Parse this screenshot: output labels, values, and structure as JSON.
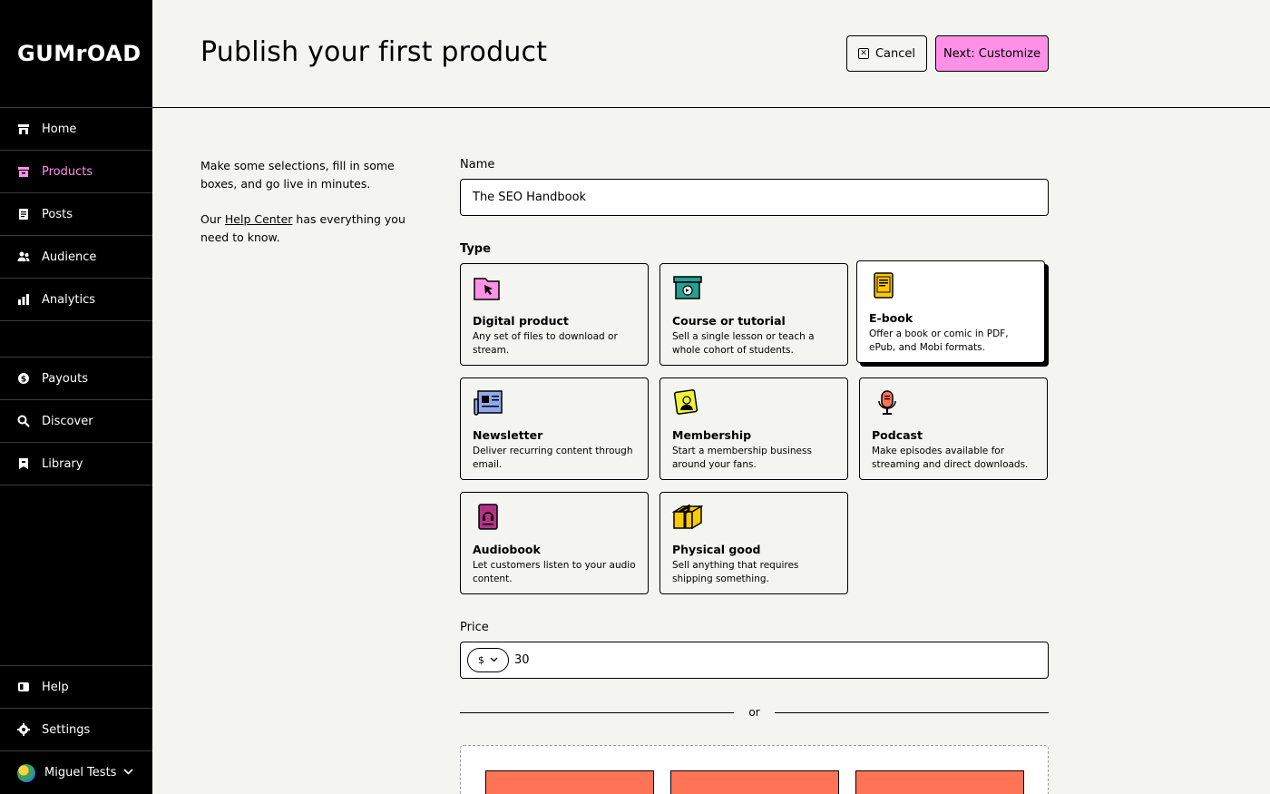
{
  "brand": {
    "logo_text": "GUMrOAD",
    "accent": "#ff90e8"
  },
  "sidebar": {
    "items": [
      {
        "label": "Home",
        "icon": "home-icon"
      },
      {
        "label": "Products",
        "icon": "products-icon",
        "active": true
      },
      {
        "label": "Posts",
        "icon": "posts-icon"
      },
      {
        "label": "Audience",
        "icon": "audience-icon"
      },
      {
        "label": "Analytics",
        "icon": "analytics-icon"
      },
      {
        "label": "Payouts",
        "icon": "payouts-icon"
      },
      {
        "label": "Discover",
        "icon": "search-icon"
      },
      {
        "label": "Library",
        "icon": "bookmark-icon"
      }
    ],
    "bottom": [
      {
        "label": "Help",
        "icon": "help-icon"
      },
      {
        "label": "Settings",
        "icon": "gear-icon"
      },
      {
        "label": "Miguel Tests",
        "icon": "avatar"
      }
    ]
  },
  "header": {
    "title": "Publish your first product",
    "cancel_label": "Cancel",
    "next_label": "Next: Customize"
  },
  "intro": {
    "line1": "Make some selections, fill in some boxes, and go live in minutes.",
    "line2_before": "Our ",
    "line2_link": "Help Center",
    "line2_after": " has everything you need to know."
  },
  "form": {
    "name_label": "Name",
    "name_value": "The SEO Handbook",
    "type_label": "Type",
    "types": [
      {
        "name": "Digital product",
        "desc": "Any set of files to download or stream.",
        "icon": "digital-product-icon",
        "color": "#ff90e8"
      },
      {
        "name": "Course or tutorial",
        "desc": "Sell a single lesson or teach a whole cohort of students.",
        "icon": "course-icon",
        "color": "#23a094"
      },
      {
        "name": "E-book",
        "desc": "Offer a book or comic in PDF, ePub, and Mobi formats.",
        "icon": "ebook-icon",
        "color": "#ffc900",
        "selected": true
      },
      {
        "name": "Newsletter",
        "desc": "Deliver recurring content through email.",
        "icon": "newsletter-icon",
        "color": "#90a8ed"
      },
      {
        "name": "Membership",
        "desc": "Start a membership business around your fans.",
        "icon": "membership-icon",
        "color": "#f1f333"
      },
      {
        "name": "Podcast",
        "desc": "Make episodes available for streaming and direct downloads.",
        "icon": "podcast-icon",
        "color": "#ff7357"
      },
      {
        "name": "Audiobook",
        "desc": "Let customers listen to your audio content.",
        "icon": "audiobook-icon",
        "color": "#b23386"
      },
      {
        "name": "Physical good",
        "desc": "Sell anything that requires shipping something.",
        "icon": "physical-good-icon",
        "color": "#ffc900"
      }
    ],
    "price_label": "Price",
    "currency": "$",
    "price_value": "30",
    "or_label": "or"
  }
}
